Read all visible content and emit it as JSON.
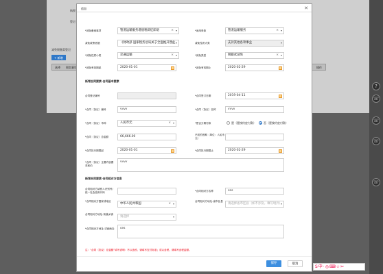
{
  "background": {
    "labels": [
      "纳税",
      "登记",
      "减免税备案登记"
    ],
    "add_button": "+ 新增",
    "table_headers": [
      "选择",
      "税务事项",
      "操作"
    ]
  },
  "modal": {
    "title": "追加",
    "close": "✕",
    "rows": [
      {
        "label": "*减免备案事项",
        "value": "管道运输服务增值税即征即退",
        "right_label": "*适用条款",
        "right_value": "管道运输服务"
      },
      {
        "label": "减免政策依据",
        "value": "《财政部 国家税务总局关于全面推开营业",
        "right_label": "减免性质大类",
        "right_value": "支持其他各项事业"
      },
      {
        "label": "*减免性质小类",
        "value": "交通运输",
        "right_label": "*减免类型",
        "right_value": "税额式减免"
      },
      {
        "label": "*减免有效期起",
        "value": "2020-01-01",
        "right_label": "*减免有效期止",
        "right_value": "2020-02-29"
      }
    ],
    "section1": "新增合同要素-合同基本要素",
    "contract": {
      "reg_no_label": "合同登记编号",
      "reg_no": "",
      "sign_date_label": "*合同签订日期",
      "sign_date": "2019-04-11",
      "code_label": "*合同（协议）编号",
      "code": "vvvv",
      "name_label": "*合同（协议）名称",
      "name": "vvvv",
      "currency_label": "*合同（协议）币种",
      "currency": "人民币元",
      "installment_label": "*是否分期付款",
      "opt_yes": "是（是按约定付款）",
      "opt_no": "否（是按约定付款）",
      "amount_label": "*合同（协议）总金额",
      "amount": "66,666.00",
      "paid_label": "已知的首期（单位：人民币元）",
      "paid": "",
      "start_label": "*合同执行期限起",
      "start": "2020-01-01",
      "end_label": "*合同执行期限止",
      "end": "2020-02-29",
      "main_label": "*合同（协议）主要内容要求和约",
      "main": "vvvv"
    },
    "section2": "新增合同要素-合同相对方信息",
    "party": {
      "taxid_label": "合同相对方纳税人识别号/统一社会信用代码",
      "taxid": "",
      "cname_label": "*合同相对方名称",
      "cname": "ces",
      "country_label": "*合同相对方国家或地区",
      "country": "中华人民共和国",
      "prov_label": "合同相对方地址-省市区县",
      "prov_ph": "请选择省市区县（如不涉及，填写境外）",
      "street_label": "合同相对方地址-街道乡镇",
      "street_ph": "请选择",
      "addr_label": "*合同相对方地址-详细地址",
      "addr": "ces"
    },
    "note": "注：“合同（协议）总金额”填写说明：不以含税，请填写支付标准；或以含税，请填写含税金额。",
    "save": "保存",
    "cancel": "取消"
  },
  "ime_bar": "S中·◎⌨☆✂"
}
